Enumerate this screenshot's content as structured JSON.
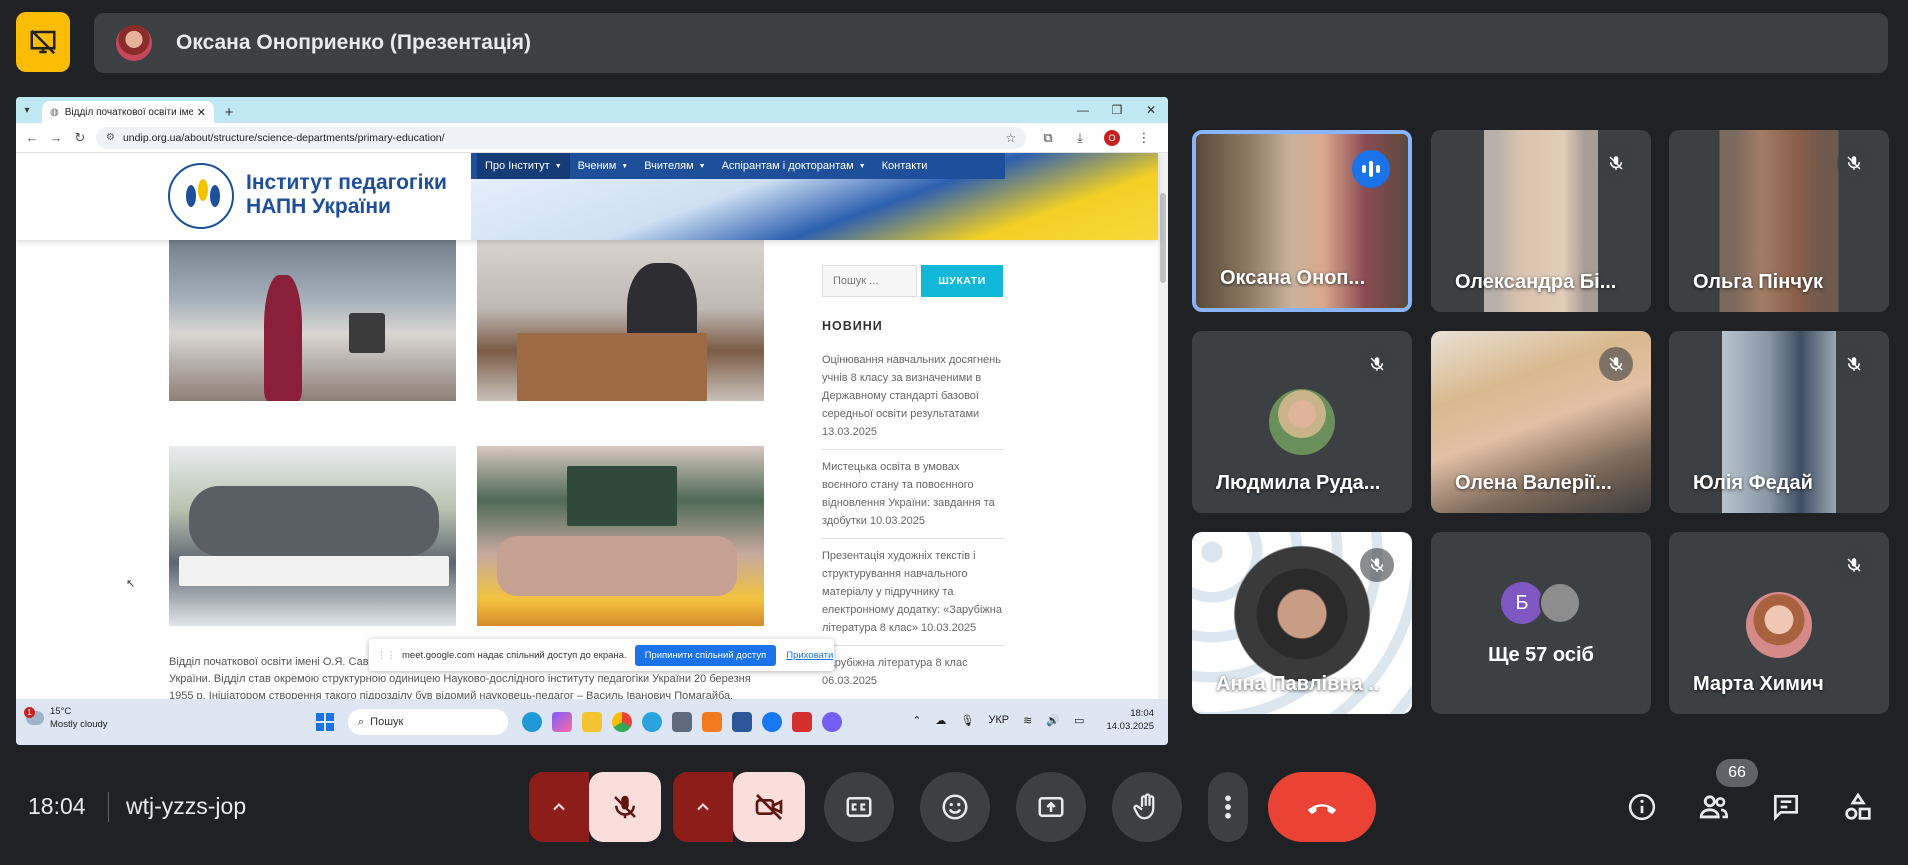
{
  "presenter": {
    "title": "Оксана Оноприенко (Презентація)"
  },
  "browser": {
    "tab_title": "Відділ початкової освіти імені",
    "url": "undip.org.ua/about/structure/science-departments/primary-education/",
    "profile_letter": "O"
  },
  "site": {
    "logo_line1": "Інститут педагогіки",
    "logo_line2": "НАПН України",
    "nav": [
      "Про Інститут",
      "Вченим",
      "Вчителям",
      "Аспірантам і докторантам",
      "Контакти"
    ],
    "search_placeholder": "Пошук ...",
    "search_button": "ШУКАТИ",
    "news_heading": "НОВИНИ",
    "news": [
      "Оцінювання навчальних досягнень учнів 8 класу за визначеними в Державному стандарті базової середньої освіти результатами 13.03.2025",
      "Мистецька освіта в умовах воєнного стану та повоєнного відновлення України: завдання та здобутки 10.03.2025",
      "Презентація художніх текстів і структурування навчального матеріалу у підручнику та електронному додатку: «Зарубіжна література 8 клас» 10.03.2025",
      "Зарубіжна література 8 клас 06.03.2025"
    ],
    "article_line1": "Відділ початкової освіти імені О.Я. Сави",
    "article_line2": "України. Відділ став окремою структурною одиницею Науково-дослідного інституту педагогіки України 20 березня",
    "article_line3": "1955 р. Ініціатором створення такого підрозділу був відомий науковець-педагог – Василь Іванович Помагайба,"
  },
  "share_banner": {
    "message": "meet.google.com надає спільний доступ до екрана.",
    "stop_label": "Припинити спільний доступ",
    "hide_label": "Приховати"
  },
  "taskbar": {
    "temperature": "15°C",
    "weather": "Mostly cloudy",
    "search": "Пошук",
    "lang": "УКР",
    "time": "18:04",
    "date": "14.03.2025"
  },
  "participants": [
    {
      "name": "Оксана Оноп...",
      "speaking": true
    },
    {
      "name": "Олександра Бі...",
      "muted": true
    },
    {
      "name": "Ольга Пінчук",
      "muted": true
    },
    {
      "name": "Людмила Руда...",
      "muted": true
    },
    {
      "name": "Олена Валерії...",
      "muted": true
    },
    {
      "name": "Юлія Федай",
      "muted": true
    },
    {
      "name": "Анна Павлівна ..",
      "muted": true
    },
    {
      "name": "Марта Химич",
      "muted": true
    }
  ],
  "more": {
    "initial": "Б",
    "label": "Ще 57 осіб"
  },
  "meeting": {
    "time": "18:04",
    "code": "wtj-yzzs-jop",
    "participant_count": "66"
  },
  "colors": {
    "background": "#202124",
    "tile": "#3c4043",
    "presentation_icon": "#fbbc04",
    "end_call": "#ea4335",
    "muted_bg": "#f9dedc",
    "muted_arrow": "#8c1d18",
    "speaking_border": "#8ab4f8"
  }
}
